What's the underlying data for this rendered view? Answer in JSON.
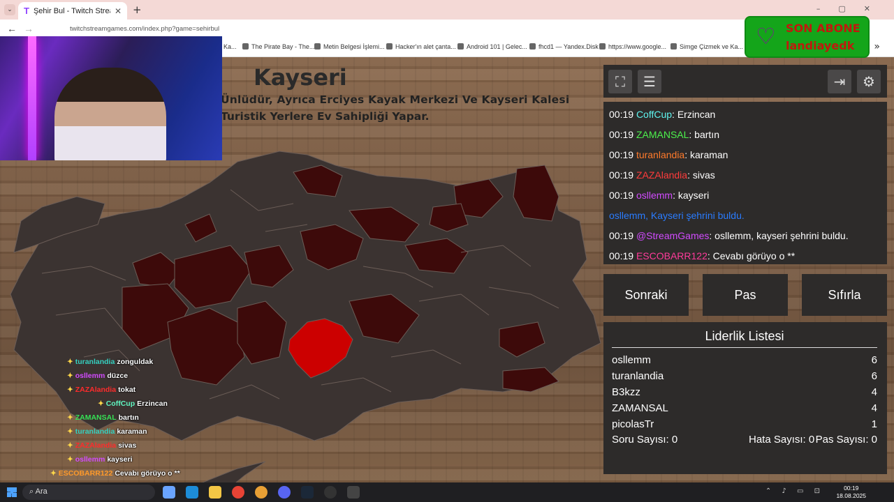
{
  "browser": {
    "tab_title": "Şehir Bul - Twitch Stream G",
    "tab_favicon": "T",
    "url": "twitchstreamgames.com/index.php?game=sehirbul",
    "bookmarks": [
      "Ka...",
      "The Pirate Bay - The...",
      "Metin Belgesi İşlemi...",
      "Hacker'ın alet çanta...",
      "Android 101 | Gelec...",
      "fhcd1 — Yandex.Disk",
      "https://www.google...",
      "Simge Çizmek ve Ka..."
    ]
  },
  "game": {
    "city": "Kayseri",
    "description_line1": "Ünlüdür, Ayrıca Erciyes Kayak Merkezi Ve Kayseri Kalesi",
    "description_line2": "Turistik Yerlere Ev Sahipliği Yapar."
  },
  "sub_alert": {
    "label": "SON ABONE",
    "name": "landiayedk"
  },
  "chat": [
    {
      "time": "00:19",
      "user": "CoffCup",
      "color": "#5ff5f0",
      "text": ": Erzincan"
    },
    {
      "time": "00:19",
      "user": "ZAMANSAL",
      "color": "#4cf04c",
      "text": ": bartın"
    },
    {
      "time": "00:19",
      "user": "turanlandia",
      "color": "#ff7a2a",
      "text": ": karaman"
    },
    {
      "time": "00:19",
      "user": "ZAZAlandia",
      "color": "#ff3b3b",
      "text": ": sivas"
    },
    {
      "time": "00:19",
      "user": "osllemm",
      "color": "#d24bff",
      "text": ": kayseri"
    },
    {
      "time": "",
      "user": "osllemm,",
      "color": "#2a7cff",
      "text": " Kayseri şehrini buldu.",
      "system": true
    },
    {
      "time": "00:19",
      "user": "@StreamGames",
      "color": "#d24bff",
      "text": ": osllemm, kayseri şehrini buldu."
    },
    {
      "time": "00:19",
      "user": "ESCOBARR122",
      "color": "#ff3b9a",
      "text": ": Cevabı görüyo o **"
    }
  ],
  "buttons": {
    "next": "Sonraki",
    "pass": "Pas",
    "reset": "Sıfırla"
  },
  "leaderboard": {
    "title": "Liderlik Listesi",
    "rows": [
      {
        "name": "osllemm",
        "score": "6"
      },
      {
        "name": "turanlandia",
        "score": "6"
      },
      {
        "name": "B3kzz",
        "score": "4"
      },
      {
        "name": "ZAMANSAL",
        "score": "4"
      },
      {
        "name": "picolasTr",
        "score": "1"
      }
    ],
    "question_count": "Soru Sayısı: 0",
    "error_count": "Hata Sayısı: 0",
    "pass_count": "Pas Sayısı: 0"
  },
  "overlay_chat": [
    {
      "user": "turanlandia",
      "color": "#35d0c0",
      "msg": "zonguldak"
    },
    {
      "user": "osllemm",
      "color": "#d24bff",
      "msg": "düzce"
    },
    {
      "user": "ZAZAlandia",
      "color": "#ff2b2b",
      "msg": "tokat"
    },
    {
      "user": "CoffCup",
      "color": "#5ff5c0",
      "msg": "Erzincan"
    },
    {
      "user": "ZAMANSAL",
      "color": "#35e055",
      "msg": "bartın"
    },
    {
      "user": "turanlandia",
      "color": "#35d0c0",
      "msg": "karaman"
    },
    {
      "user": "ZAZAlandia",
      "color": "#ff2b2b",
      "msg": "sivas"
    },
    {
      "user": "osllemm",
      "color": "#d24bff",
      "msg": "kayseri"
    },
    {
      "user": "ESCOBARR122",
      "color": "#ff9a2a",
      "msg": "Cevabı görüyo o **"
    }
  ],
  "taskbar": {
    "search_placeholder": "Ara",
    "time": "00:19",
    "date": "18.08.2025"
  },
  "map_colors": {
    "land": "#3b3331",
    "found": "#3d0a0a",
    "current": "#cc0000",
    "border": "#6b5d57"
  }
}
